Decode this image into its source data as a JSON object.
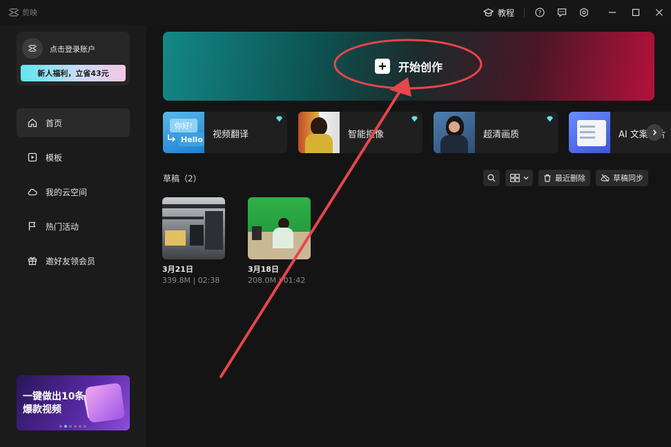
{
  "app": {
    "name": "剪映"
  },
  "titlebar": {
    "tutorial_label": "教程"
  },
  "account": {
    "login_label": "点击登录账户",
    "promo_label": "新人福利，立省43元"
  },
  "nav": {
    "items": [
      {
        "label": "首页",
        "icon": "home-icon",
        "active": true
      },
      {
        "label": "模板",
        "icon": "template-icon",
        "active": false
      },
      {
        "label": "我的云空间",
        "icon": "cloud-icon",
        "active": false
      },
      {
        "label": "热门活动",
        "icon": "flag-icon",
        "active": false
      },
      {
        "label": "邀好友领会员",
        "icon": "gift-icon",
        "active": false
      }
    ]
  },
  "side_banner": {
    "text": "一键做出10条爆款视频"
  },
  "create": {
    "label": "开始创作"
  },
  "tools": [
    {
      "label": "视频翻译",
      "thumb_text_1": "你好!",
      "thumb_text_2": "Hello"
    },
    {
      "label": "智能抠像"
    },
    {
      "label": "超清画质"
    },
    {
      "label": "AI 文案成片"
    }
  ],
  "drafts": {
    "title": "草稿（2）",
    "recent_delete_label": "最近删除",
    "sync_label": "草稿同步",
    "items": [
      {
        "date": "3月21日",
        "meta": "339.8M | 02:38"
      },
      {
        "date": "3月18日",
        "meta": "208.0M | 01:42"
      }
    ]
  },
  "colors": {
    "annotation": "#e8454c",
    "accent_teal": "#138887",
    "accent_red": "#b5113a"
  }
}
